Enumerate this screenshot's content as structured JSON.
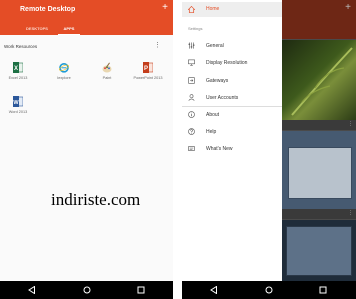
{
  "left_screen": {
    "app_title": "Remote Desktop",
    "add_symbol": "+",
    "tabs": [
      {
        "label": "DESKTOPS",
        "active": false
      },
      {
        "label": "APPS",
        "active": true
      }
    ],
    "section_title": "Work Resources",
    "section_menu_symbol": "⋮",
    "apps": [
      {
        "label": "Excel 2013",
        "icon": "excel-icon",
        "color": "#1d7044"
      },
      {
        "label": "Iexplore",
        "icon": "internet-explorer-icon",
        "color": "#1e9bd7"
      },
      {
        "label": "Paint",
        "icon": "paint-icon",
        "color": "#d9a441"
      },
      {
        "label": "PowerPoint 2013",
        "icon": "powerpoint-icon",
        "color": "#c43e1c"
      },
      {
        "label": "Word 2013",
        "icon": "word-icon",
        "color": "#2b579a"
      }
    ],
    "watermark": "indiriste.com"
  },
  "right_screen": {
    "drawer": {
      "home": {
        "label": "Home",
        "icon": "home-icon",
        "active": true
      },
      "settings_header": "Settings",
      "items": [
        {
          "label": "General",
          "icon": "sliders-icon"
        },
        {
          "label": "Display Resolution",
          "icon": "monitor-icon"
        },
        {
          "label": "Gateways",
          "icon": "gateway-icon"
        },
        {
          "label": "User Accounts",
          "icon": "user-icon"
        },
        {
          "label": "About",
          "icon": "info-icon"
        },
        {
          "label": "Help",
          "icon": "help-icon"
        },
        {
          "label": "What's New",
          "icon": "whats-new-icon"
        }
      ]
    },
    "add_symbol": "+"
  },
  "colors": {
    "accent": "#e44d26",
    "status_bar": "#c8371f",
    "nav_bar": "#000000"
  }
}
